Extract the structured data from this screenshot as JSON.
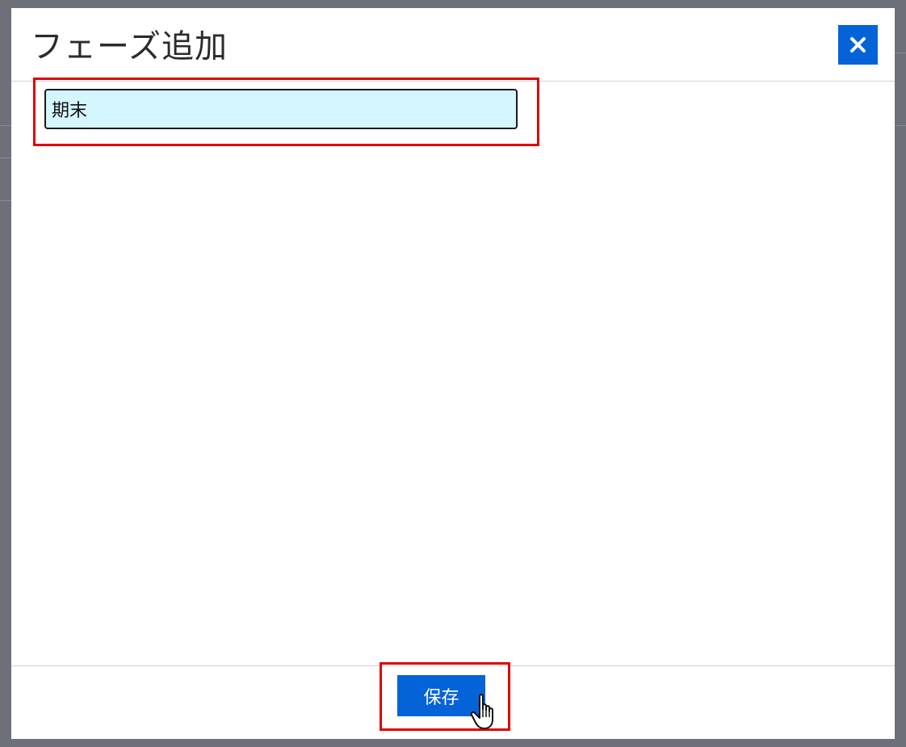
{
  "dialog": {
    "title": "フェーズ追加",
    "close_icon": "close-icon"
  },
  "form": {
    "phase_name_value": "期末"
  },
  "footer": {
    "save_label": "保存"
  },
  "colors": {
    "accent": "#0563d8",
    "highlight": "#e00000",
    "input_bg": "#d4f6ff",
    "overlay": "#6d7078"
  },
  "cursor": {
    "icon": "hand-pointer-icon"
  }
}
